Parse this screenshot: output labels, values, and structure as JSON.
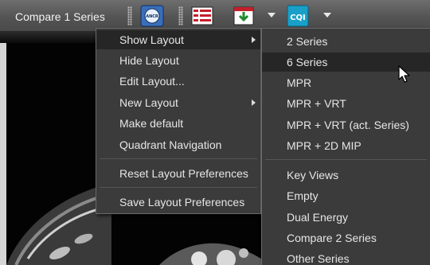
{
  "toolbar": {
    "title": "Compare 1 Series",
    "anchr_label": "ANCR",
    "cqi_label": "CQI"
  },
  "main_menu": {
    "items": [
      {
        "label": "Show Layout",
        "submenu": true,
        "highlighted": true
      },
      {
        "label": "Hide Layout"
      },
      {
        "label": "Edit Layout..."
      },
      {
        "label": "New Layout",
        "submenu": true
      },
      {
        "label": "Make default"
      },
      {
        "label": "Quadrant Navigation"
      },
      {
        "label": "Reset Layout Preferences"
      },
      {
        "label": "Save Layout Preferences"
      }
    ]
  },
  "layout_submenu": {
    "items": [
      {
        "label": "2 Series"
      },
      {
        "label": "6 Series",
        "highlighted": true
      },
      {
        "label": "MPR"
      },
      {
        "label": "MPR + VRT"
      },
      {
        "label": "MPR + VRT (act. Series)"
      },
      {
        "label": "MPR + 2D MIP"
      },
      {
        "label": "Key Views"
      },
      {
        "label": "Empty"
      },
      {
        "label": "Dual Energy"
      },
      {
        "label": "Compare 2 Series"
      },
      {
        "label": "Other Series"
      }
    ]
  },
  "colors": {
    "menu_bg": "#3b3b3b",
    "highlight_bg": "#262626",
    "text": "#e6e6e6",
    "cqi_accent": "#1aa0c8",
    "anchr_accent": "#2b5fa8"
  }
}
